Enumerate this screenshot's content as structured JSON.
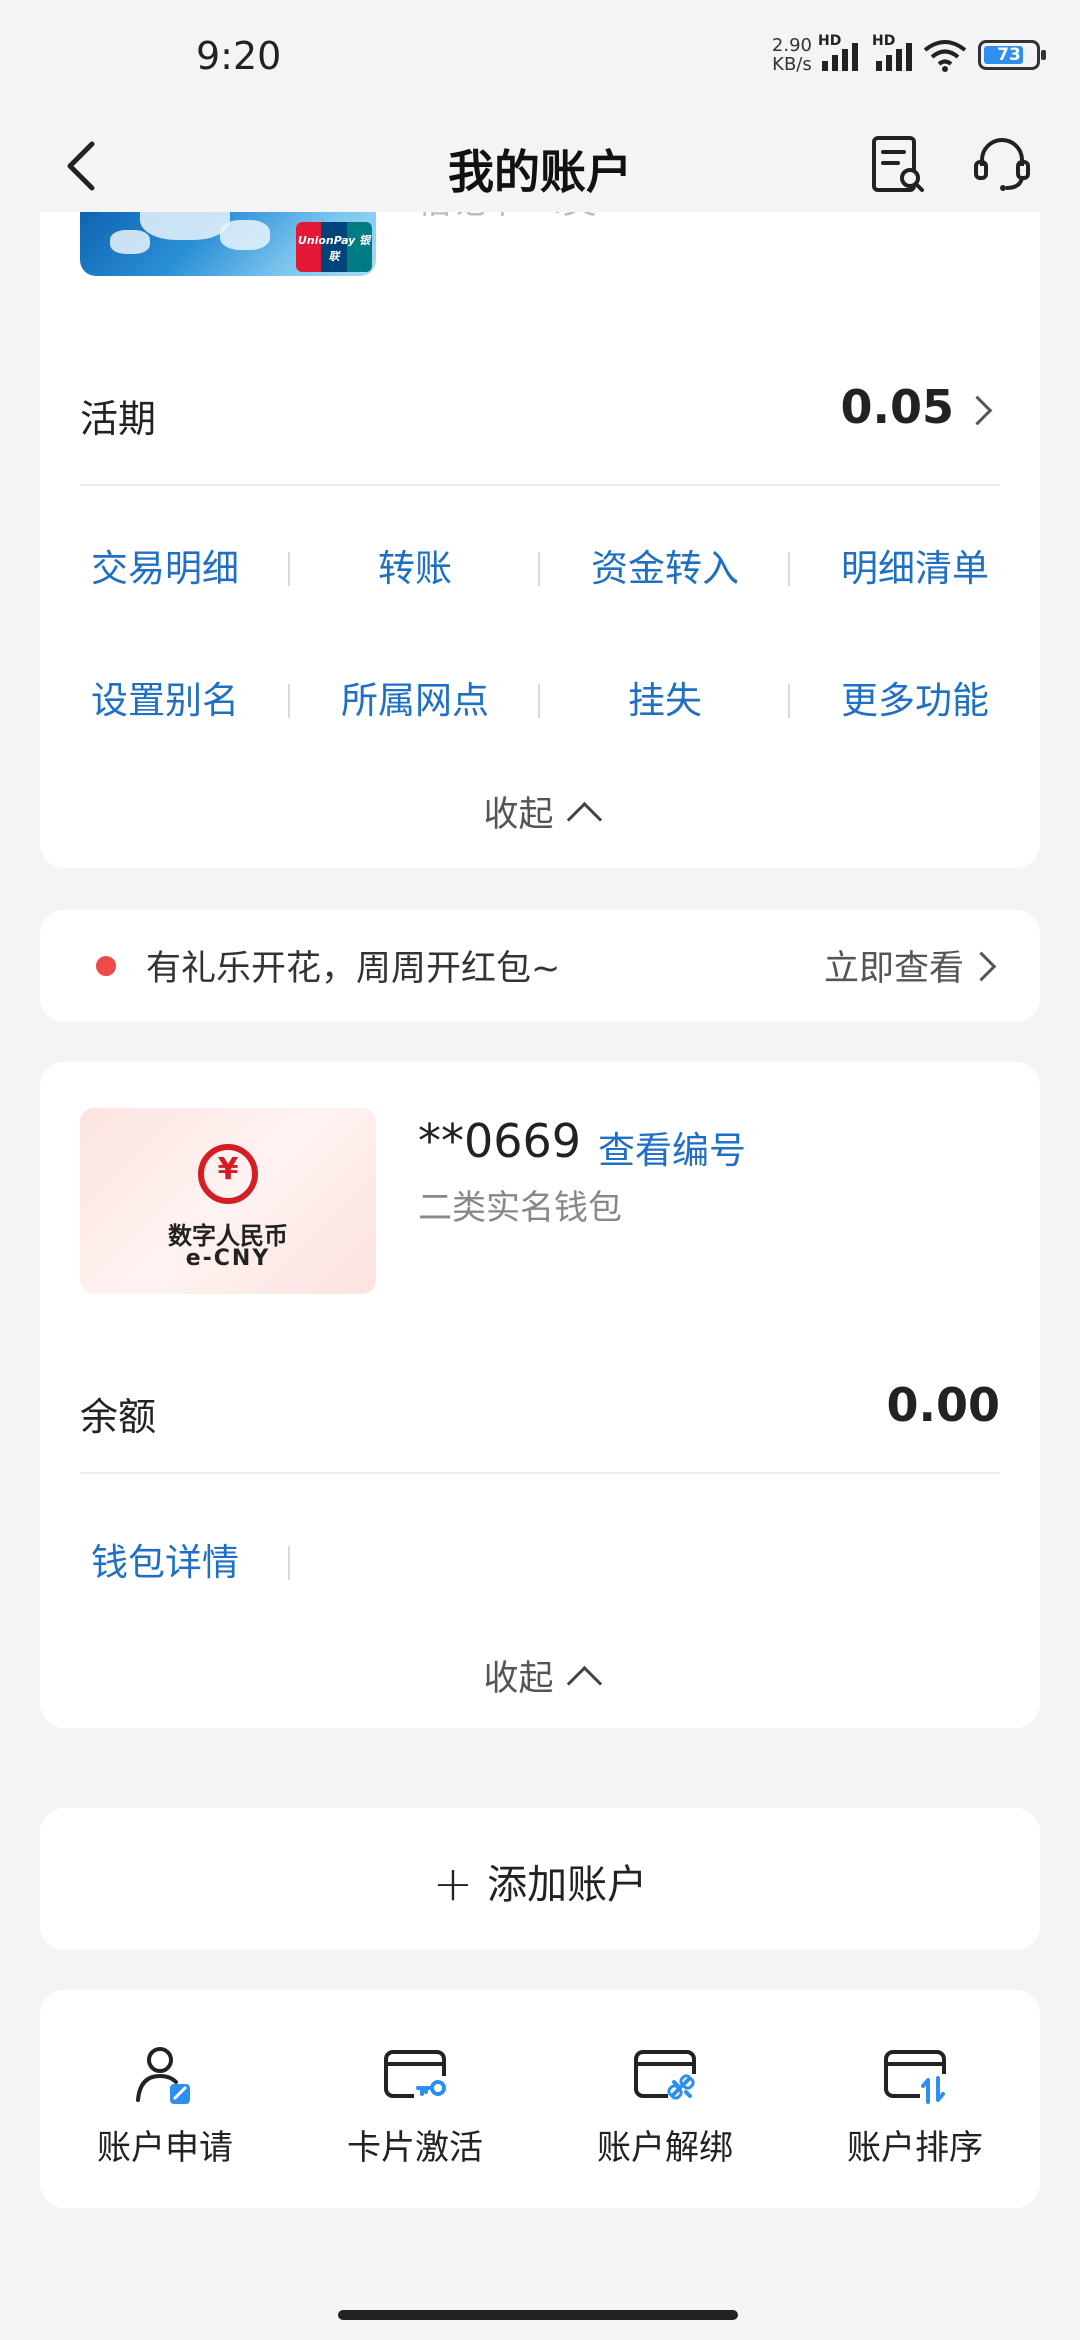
{
  "status_bar": {
    "time": "9:20",
    "net_speed_value": "2.90",
    "net_speed_unit": "KB/s",
    "signal_label": "HD",
    "battery": "73"
  },
  "header": {
    "title": "我的账户"
  },
  "debit_card": {
    "partial_text": "借记卡 · I类",
    "unionpay_label": "UnionPay 银联",
    "balance_label": "活期",
    "balance_value": "0.05",
    "actions": [
      "交易明细",
      "转账",
      "资金转入",
      "明细清单",
      "设置别名",
      "所属网点",
      "挂失",
      "更多功能"
    ],
    "collapse_label": "收起"
  },
  "promo": {
    "text": "有礼乐开花，周周开红包~",
    "link": "立即查看"
  },
  "ecny_wallet": {
    "logo_cn": "数字人民币",
    "logo_en": "e-CNY",
    "account_no": "**0669",
    "view_number_link": "查看编号",
    "wallet_type": "二类实名钱包",
    "balance_label": "余额",
    "balance_value": "0.00",
    "actions": [
      "钱包详情"
    ],
    "collapse_label": "收起"
  },
  "add_account": {
    "label": "添加账户"
  },
  "tools": [
    {
      "label": "账户申请",
      "icon": "person-edit-icon"
    },
    {
      "label": "卡片激活",
      "icon": "card-key-icon"
    },
    {
      "label": "账户解绑",
      "icon": "card-unlink-icon"
    },
    {
      "label": "账户排序",
      "icon": "card-sort-icon"
    }
  ],
  "colors": {
    "accent_blue": "#1f6fc5",
    "icon_blue": "#2d8ff0",
    "promo_dot": "#ee4a4a",
    "background": "#f4f4f6"
  }
}
